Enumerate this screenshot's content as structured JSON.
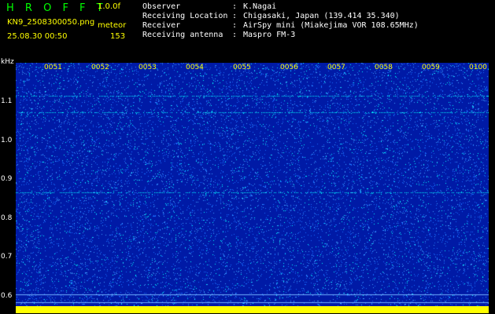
{
  "header": {
    "title": "H R O F F T",
    "version": "1.0.0f",
    "filename": "KN9_2508300050.png",
    "meteor_label": "meteor",
    "datetime": "25.08.30 00:50",
    "meteor_count": "153"
  },
  "info": [
    {
      "key": "Observer",
      "value": "K.Nagai"
    },
    {
      "key": "Receiving Location",
      "value": "Chigasaki, Japan (139.414 35.340)"
    },
    {
      "key": "Receiver",
      "value": "AirSpy mini (Miakejima VOR 108.65MHz)"
    },
    {
      "key": "Receiving antenna",
      "value": "Maspro FM-3"
    }
  ],
  "info_separator": ":",
  "spectrogram": {
    "y_unit": "kHz",
    "y_ticks": [
      "1.1",
      "1.0",
      "0.9",
      "0.8",
      "0.7",
      "0.6"
    ],
    "y_tick_values": [
      1.1,
      1.0,
      0.9,
      0.8,
      0.7,
      0.6
    ],
    "y_range": [
      0.585,
      1.2
    ],
    "time_labels": [
      "0051",
      "0052",
      "0053",
      "0054",
      "0055",
      "0056",
      "0057",
      "0058",
      "0059",
      "0100"
    ],
    "colors": {
      "background": "#001aa6",
      "noise_low": "#1a6cff",
      "noise_high": "#00ffff",
      "baseline": "#ffff00"
    }
  }
}
